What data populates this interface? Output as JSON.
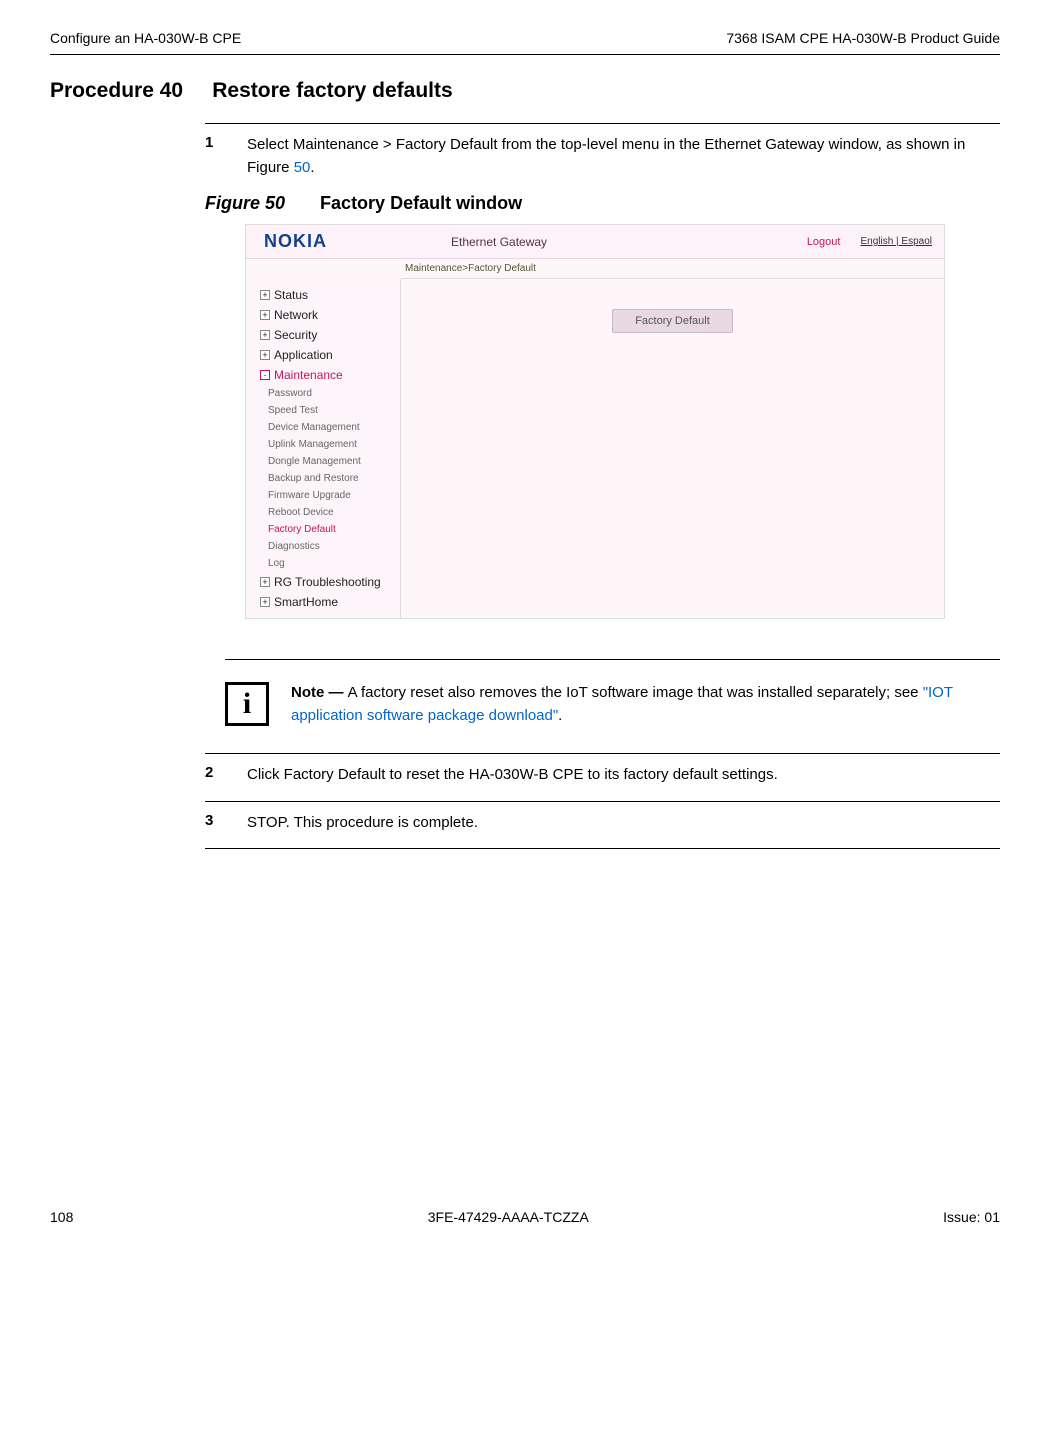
{
  "header": {
    "left": "Configure an HA-030W-B CPE",
    "right": "7368 ISAM CPE HA-030W-B Product Guide"
  },
  "procedure": {
    "label": "Procedure 40",
    "title": "Restore factory defaults"
  },
  "step1": {
    "num": "1",
    "text_a": "Select Maintenance > Factory Default from the top-level menu in the Ethernet Gateway window, as shown in Figure ",
    "link": "50",
    "text_b": "."
  },
  "figure": {
    "label": "Figure 50",
    "title": "Factory Default window"
  },
  "screenshot": {
    "logo": "NOKIA",
    "gateway_title": "Ethernet Gateway",
    "logout": "Logout",
    "lang": "English | Espaol",
    "breadcrumb": "Maintenance>Factory Default",
    "nav": {
      "status": "Status",
      "network": "Network",
      "security": "Security",
      "application": "Application",
      "maintenance": "Maintenance",
      "password": "Password",
      "speed_test": "Speed Test",
      "device_mgmt": "Device Management",
      "uplink_mgmt": "Uplink Management",
      "dongle_mgmt": "Dongle Management",
      "backup": "Backup and Restore",
      "firmware": "Firmware Upgrade",
      "reboot": "Reboot Device",
      "factory_default": "Factory Default",
      "diagnostics": "Diagnostics",
      "log": "Log",
      "rg_troubleshooting": "RG Troubleshooting",
      "smarthome": "SmartHome"
    },
    "button": "Factory Default"
  },
  "note": {
    "prefix": "Note — ",
    "text_a": "A factory reset also removes the IoT software image that was installed separately; see ",
    "link": "\"IOT application software package download\"",
    "text_b": "."
  },
  "step2": {
    "num": "2",
    "text": "Click Factory Default to reset the HA-030W-B CPE to its factory default settings."
  },
  "step3": {
    "num": "3",
    "text": "STOP. This procedure is complete."
  },
  "footer": {
    "page": "108",
    "docnum": "3FE-47429-AAAA-TCZZA",
    "issue": "Issue: 01"
  }
}
